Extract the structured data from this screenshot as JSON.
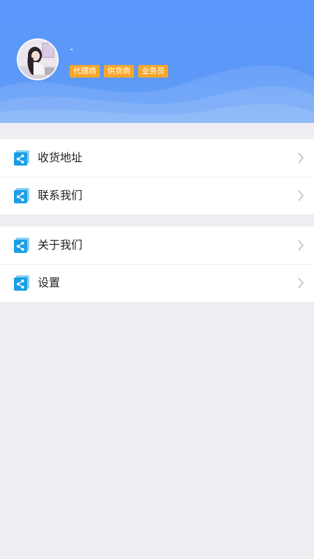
{
  "profile": {
    "username": "-",
    "tags": [
      "代理商",
      "供货商",
      "业务员"
    ]
  },
  "menu": {
    "groups": [
      {
        "items": [
          {
            "label": "收货地址",
            "icon": "share-icon"
          },
          {
            "label": "联系我们",
            "icon": "share-icon"
          }
        ]
      },
      {
        "items": [
          {
            "label": "关于我们",
            "icon": "share-icon"
          },
          {
            "label": "设置",
            "icon": "share-icon"
          }
        ]
      }
    ]
  },
  "colors": {
    "header_blue": "#5b97fb",
    "tag_orange": "#f5a72b",
    "icon_blue": "#1a9fe6",
    "background": "#efedf1"
  }
}
